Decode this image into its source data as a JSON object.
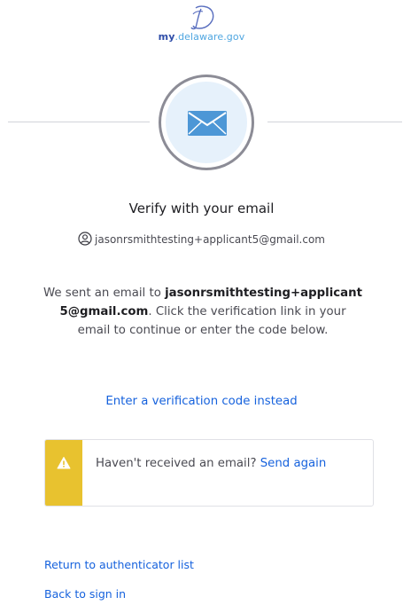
{
  "logo": {
    "my": "my",
    "rest": ".delaware.gov"
  },
  "header": {
    "title": "Verify with your email",
    "identifier": "jasonrsmithtesting+applicant5@gmail.com"
  },
  "instructions": {
    "part1": "We sent an email to ",
    "email": "jasonrsmithtesting+applicant5@gmail.com",
    "part2": ". Click the verification link in your email to continue or enter the code below."
  },
  "actions": {
    "enter_code": "Enter a verification code instead"
  },
  "callout": {
    "text": "Haven't received an email? ",
    "link": "Send again"
  },
  "footer": {
    "return": "Return to authenticator list",
    "back": "Back to sign in"
  },
  "colors": {
    "link": "#1662dd",
    "warning": "#e8c22f",
    "beacon_bg": "#e6f1fb",
    "mail": "#4d97d6"
  },
  "icons": {
    "logo": "delaware-d-logo",
    "beacon": "mail-icon",
    "identifier": "person-icon",
    "callout": "warning-icon"
  }
}
